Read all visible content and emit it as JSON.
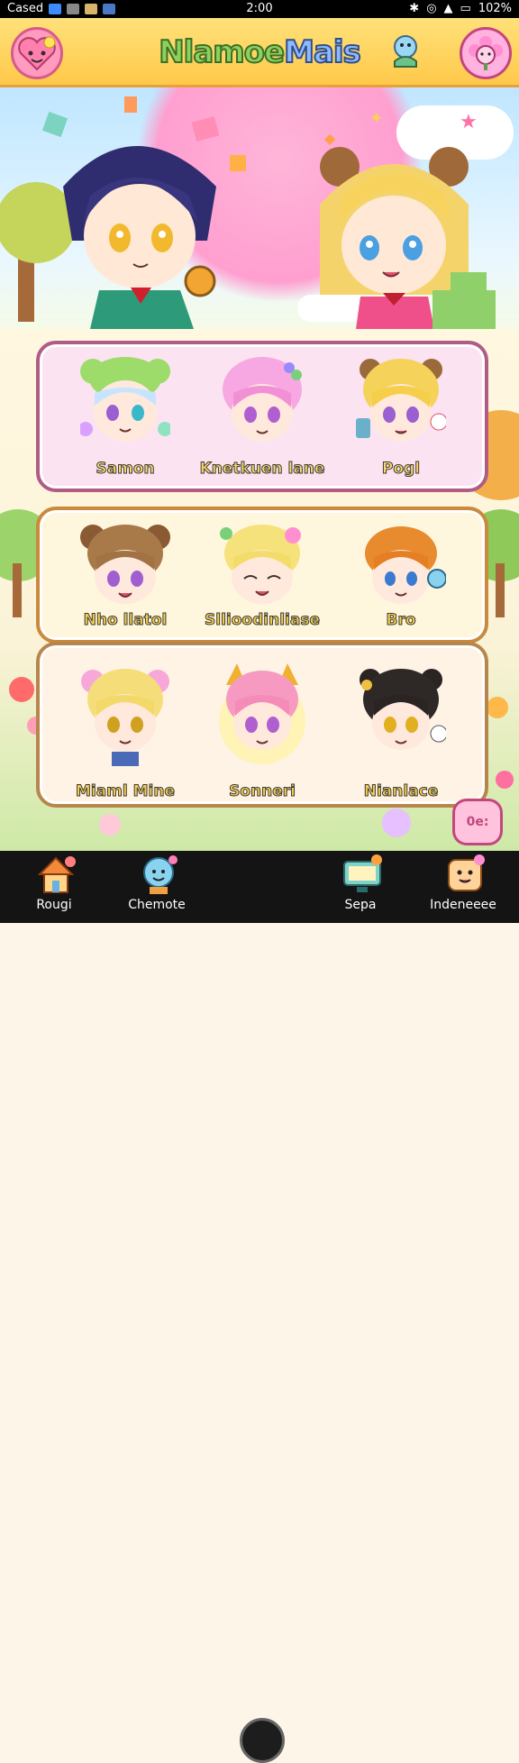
{
  "status_bar": {
    "carrier": "Cased",
    "time": "2:00",
    "battery": "102%"
  },
  "header": {
    "title_part1": "Nlamoe",
    "title_part2": "Mais"
  },
  "characters": [
    [
      {
        "name": "Samon"
      },
      {
        "name": "Knetkuen lane"
      },
      {
        "name": "Pogl"
      }
    ],
    [
      {
        "name": "Nho llatol"
      },
      {
        "name": "Sllioodinliase"
      },
      {
        "name": "Bro"
      }
    ],
    [
      {
        "name": "Miaml Mine"
      },
      {
        "name": "Sonneri"
      },
      {
        "name": "Nianlace"
      }
    ]
  ],
  "side_button": {
    "label": "0e:"
  },
  "bottom_nav": [
    {
      "label": "Rougi",
      "icon": "house-icon"
    },
    {
      "label": "Chemote",
      "icon": "character-icon"
    },
    {
      "label": "Sepa",
      "icon": "tv-icon"
    },
    {
      "label": "Indeneeee",
      "icon": "cookie-icon"
    }
  ],
  "colors": {
    "header": "#ffc94a",
    "card_pink": "#fbe3f1",
    "card_cream": "#fff6de",
    "accent_pink": "#c4467f"
  }
}
